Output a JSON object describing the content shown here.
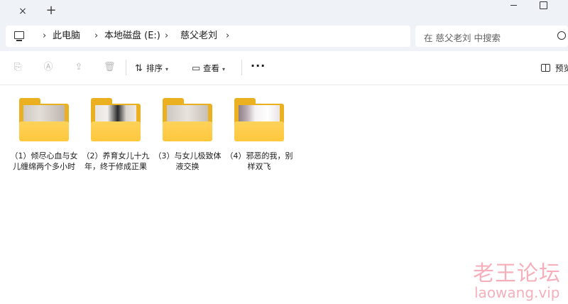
{
  "tabbar": {
    "close_glyph": "×",
    "new_tab_glyph": "+"
  },
  "address_bar": {
    "crumbs": [
      "此电脑",
      "本地磁盘 (E:)",
      "慈父老刘"
    ],
    "separator": "›"
  },
  "search": {
    "placeholder": "在 慈父老刘 中搜索"
  },
  "toolbar": {
    "sort_label": "排序",
    "view_label": "查看",
    "more_label": "···",
    "preview_label": "预览"
  },
  "folders": [
    {
      "label": "（1）倾尽心血与女儿缠绵两个多小时"
    },
    {
      "label": "（2）养育女儿十九年，终于修成正果"
    },
    {
      "label": "（3）与女儿极致体液交换"
    },
    {
      "label": "（4）邪恶的我，别样双飞"
    }
  ],
  "watermark": {
    "cn": "老王论坛",
    "en": "laowang.vip"
  },
  "colors": {
    "chrome_bg": "#eff2f7",
    "folder_back": "#eab01f",
    "folder_front": "#ffc83d",
    "watermark": "#f07c8e"
  }
}
